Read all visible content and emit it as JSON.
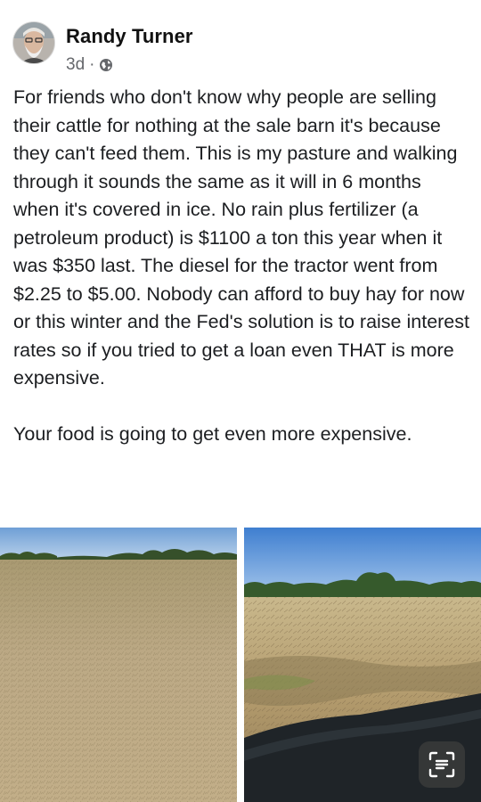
{
  "post": {
    "author_name": "Randy Turner",
    "timestamp": "3d",
    "separator": "·",
    "privacy_icon": "globe-icon",
    "paragraphs": [
      "For friends who don't know why people are selling their cattle for nothing at the sale barn it's because they can't feed them. This is my pasture and walking through it sounds the same as it will in 6 months when it's covered in ice. No rain plus fertilizer (a petroleum product) is $1100 a ton this year when it was $350 last. The diesel for the tractor went from $2.25 to $5.00. Nobody can afford to buy hay for now or this winter and the Fed's solution is to raise interest rates so if you tried to get a loan even THAT is more expensive.",
      "Your food is going to get even more expensive."
    ]
  },
  "photos": [
    {
      "name": "dry-pasture-photo"
    },
    {
      "name": "dry-pasture-photo-2"
    }
  ],
  "overlay": {
    "scan_icon": "scan-text-icon"
  },
  "colors": {
    "text": "#1c1e21",
    "meta_text": "#65676b",
    "sky": "#8fb6e0",
    "dry_grass": "#b9a882",
    "trees": "#3f5a2e"
  }
}
